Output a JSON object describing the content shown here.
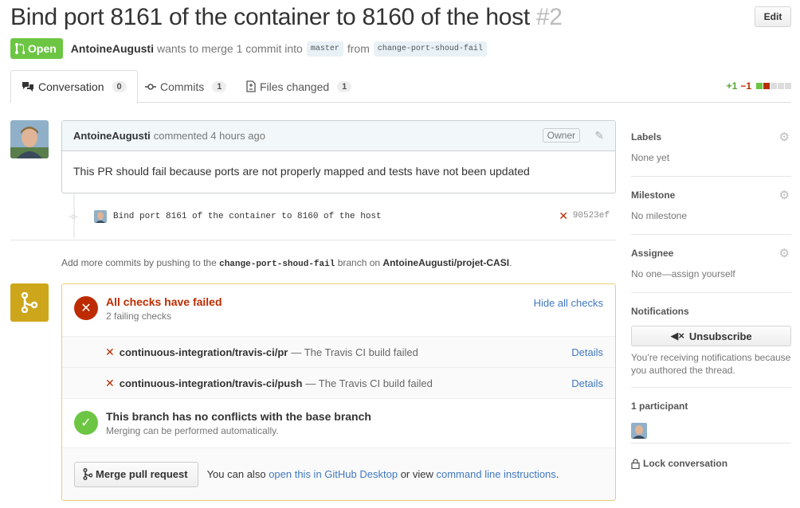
{
  "pr": {
    "title": "Bind port 8161 of the container to 8160 of the host",
    "number": "#2",
    "edit_label": "Edit",
    "state": "Open",
    "author": "AntoineAugusti",
    "merge_text_1": "wants to merge 1 commit into",
    "base_branch": "master",
    "from_text": "from",
    "head_branch": "change-port-shoud-fail"
  },
  "tabs": [
    {
      "label": "Conversation",
      "count": "0"
    },
    {
      "label": "Commits",
      "count": "1"
    },
    {
      "label": "Files changed",
      "count": "1"
    }
  ],
  "diffstat": {
    "additions": "+1",
    "deletions": "−1"
  },
  "comment": {
    "author": "AntoineAugusti",
    "action": "commented 4 hours ago",
    "owner_badge": "Owner",
    "body": "This PR should fail because ports are not properly mapped and tests have not been updated"
  },
  "commit": {
    "message": "Bind port 8161 of the container to 8160 of the host",
    "status_mark": "✕",
    "sha": "90523ef"
  },
  "push_hint": {
    "prefix": "Add more commits by pushing to the",
    "branch": "change-port-shoud-fail",
    "middle": "branch on",
    "repo": "AntoineAugusti/projet-CASI",
    "suffix": "."
  },
  "checks": {
    "title": "All checks have failed",
    "subtitle": "2 failing checks",
    "hide_label": "Hide all checks",
    "items": [
      {
        "name": "continuous-integration/travis-ci/pr",
        "desc": "— The Travis CI build failed",
        "details": "Details"
      },
      {
        "name": "continuous-integration/travis-ci/push",
        "desc": "— The Travis CI build failed",
        "details": "Details"
      }
    ]
  },
  "conflicts": {
    "title": "This branch has no conflicts with the base branch",
    "subtitle": "Merging can be performed automatically."
  },
  "merge": {
    "button_label": "Merge pull request",
    "text_1": "You can also",
    "link_1": "open this in GitHub Desktop",
    "text_2": "or view",
    "link_2": "command line instructions",
    "text_3": "."
  },
  "sidebar": {
    "labels_heading": "Labels",
    "labels_value": "None yet",
    "milestone_heading": "Milestone",
    "milestone_value": "No milestone",
    "assignee_heading": "Assignee",
    "assignee_value": "No one—assign yourself",
    "notifications_heading": "Notifications",
    "unsubscribe_label": "Unsubscribe",
    "notifications_text": "You’re receiving notifications because you authored the thread.",
    "participants_heading": "1 participant",
    "lock_label": "Lock conversation"
  },
  "colors": {
    "open_green": "#6cc644",
    "fail_red": "#bd2c00",
    "success_green": "#6cc644",
    "pending_yellow": "#cea61b",
    "link_blue": "#4078c0"
  },
  "icons": [
    "git-pull-request-icon",
    "comment-icon",
    "commit-icon",
    "file-diff-icon",
    "pencil-icon",
    "x-icon",
    "check-icon",
    "git-merge-icon",
    "gear-icon",
    "mute-icon",
    "lock-icon"
  ]
}
